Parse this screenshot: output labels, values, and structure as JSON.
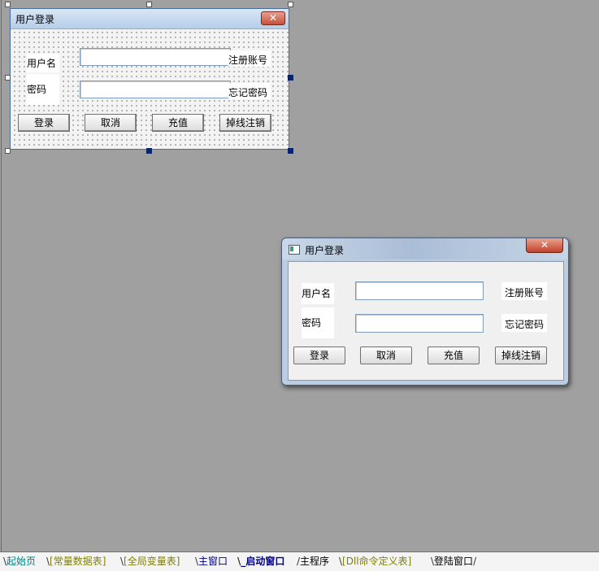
{
  "design_form": {
    "title": "用户登录",
    "close_glyph": "✕",
    "username_label": "用户名",
    "password_label": "密码",
    "register_label": "注册账号",
    "forgot_label": "忘记密码",
    "buttons": [
      "登录",
      "取消",
      "充值",
      "掉线注销"
    ]
  },
  "run_window": {
    "title": "用户登录",
    "close_glyph": "✕",
    "username_label": "用户名",
    "password_label": "密码",
    "register_label": "注册账号",
    "forgot_label": "忘记密码",
    "buttons": [
      "登录",
      "取消",
      "充值",
      "掉线注销"
    ]
  },
  "tabs": [
    {
      "label": "起始页",
      "color": "#008080"
    },
    {
      "label": "[常量数据表]",
      "color": "#808000"
    },
    {
      "label": "[全局变量表]",
      "color": "#808000"
    },
    {
      "label": "主窗口",
      "color": "#000080"
    },
    {
      "label": "_启动窗口",
      "color": "#000080",
      "active": true
    },
    {
      "label": "主程序",
      "color": "#000000"
    },
    {
      "label": "[Dll命令定义表]",
      "color": "#808000"
    },
    {
      "label": "登陆窗口",
      "color": "#000000"
    }
  ],
  "colors": {
    "workspace": "#a0a0a0",
    "teal_tab": "#008080",
    "olive_tab": "#808000",
    "navy_tab": "#000080"
  }
}
